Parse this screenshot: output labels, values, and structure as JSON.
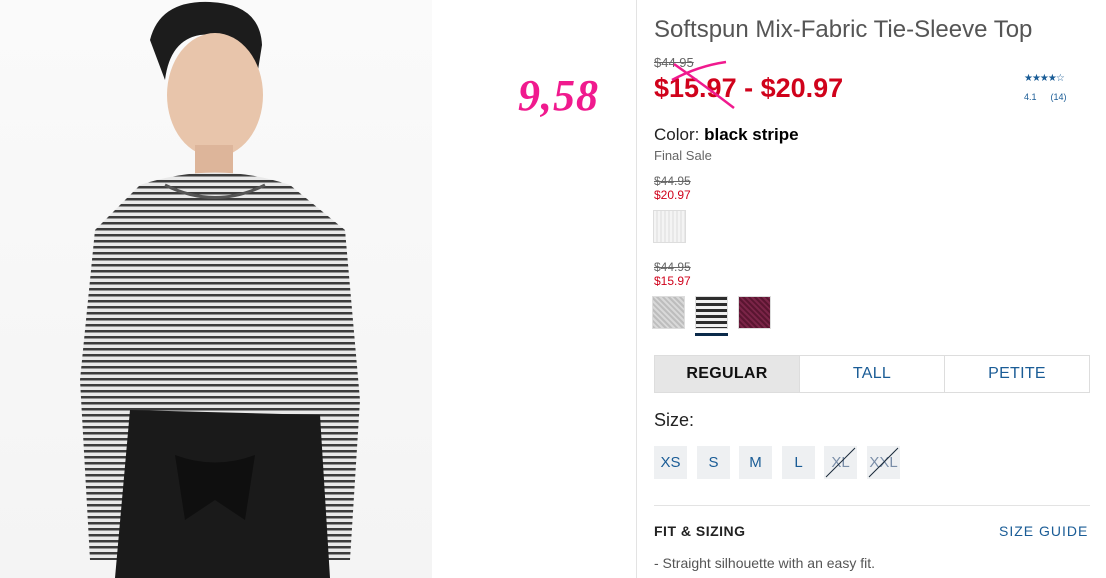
{
  "product": {
    "title": "Softspun Mix-Fabric Tie-Sleeve Top",
    "original_price": "$44.95",
    "sale_price_range": "$15.97 - $20.97",
    "annotation": "9,58",
    "rating": {
      "stars": "★★★★☆",
      "score": "4.1",
      "count": "(14)"
    },
    "color": {
      "label": "Color:",
      "value": "black stripe"
    },
    "final_sale": "Final Sale"
  },
  "price_groups": [
    {
      "was": "$44.95",
      "now": "$20.97"
    },
    {
      "was": "$44.95",
      "now": "$15.97"
    }
  ],
  "swatches": [
    {
      "name": "white",
      "color": "#eeeeee"
    },
    {
      "name": "light gray",
      "color": "#cfcfcf"
    },
    {
      "name": "black stripe",
      "color": "#2d2d2d",
      "selected": true
    },
    {
      "name": "burgundy",
      "color": "#6a1c3c"
    }
  ],
  "fit_tabs": [
    "REGULAR",
    "TALL",
    "PETITE"
  ],
  "size": {
    "label": "Size:",
    "options": [
      "XS",
      "S",
      "M",
      "L",
      "XL",
      "XXL"
    ]
  },
  "fit_sizing": {
    "heading": "FIT & SIZING",
    "guide_link": "SIZE GUIDE",
    "bullet": "- Straight silhouette with an easy fit."
  },
  "colors": {
    "sale_red": "#d0021b",
    "link_blue": "#1a5c96",
    "annotation_pink": "#f01a8e"
  }
}
